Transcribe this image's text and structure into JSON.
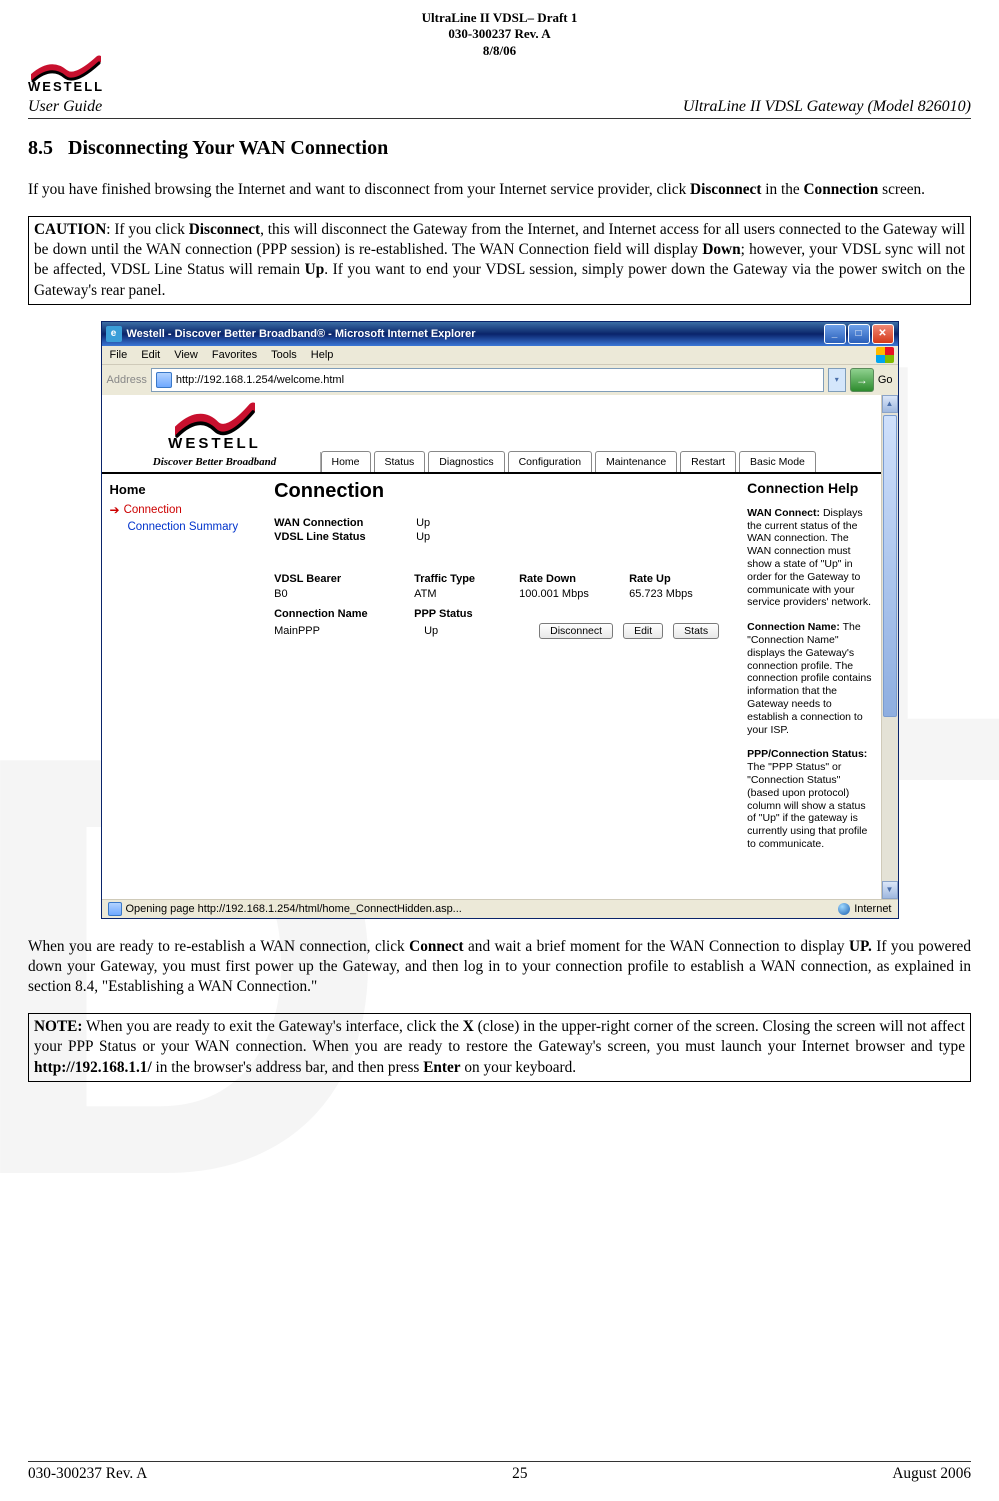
{
  "header": {
    "line1": "UltraLine II VDSL– Draft 1",
    "line2": "030-300237 Rev. A",
    "line3": "8/8/06",
    "logo_text": "WESTELL",
    "guide_left": "User Guide",
    "guide_right": "UltraLine II VDSL Gateway (Model 826010)"
  },
  "section": {
    "number": "8.5",
    "title": "Disconnecting Your WAN Connection"
  },
  "para1": {
    "t1": "If you have finished browsing the Internet and want to disconnect from your Internet service provider, click ",
    "b1": "Disconnect",
    "t2": " in the ",
    "b2": "Connection",
    "t3": " screen."
  },
  "caution": {
    "b1": "CAUTION",
    "t1": ": If you click ",
    "b2": "Disconnect",
    "t2": ", this will disconnect the Gateway from the Internet, and Internet access for all users connected to the Gateway will be down until the WAN connection (PPP session) is re-established. The WAN Connection field will display ",
    "b3": "Down",
    "t3": "; however, your VDSL sync will not be affected, VDSL Line Status will remain ",
    "b4": "Up",
    "t4": ". If you want to end your VDSL session, simply power down the Gateway via the power switch on the Gateway's rear panel."
  },
  "screenshot": {
    "title": "Westell - Discover Better Broadband® - Microsoft Internet Explorer",
    "menu": [
      "File",
      "Edit",
      "View",
      "Favorites",
      "Tools",
      "Help"
    ],
    "address_label": "Address",
    "address_value": "http://192.168.1.254/welcome.html",
    "go_label": "Go",
    "logo_text": "WESTELL",
    "tagline": "Discover Better Broadband",
    "tabs": [
      "Home",
      "Status",
      "Diagnostics",
      "Configuration",
      "Maintenance",
      "Restart",
      "Basic Mode"
    ],
    "side": {
      "heading": "Home",
      "current": "Connection",
      "sub": "Connection Summary"
    },
    "main": {
      "title": "Connection",
      "kv": [
        {
          "k": "WAN Connection",
          "v": "Up"
        },
        {
          "k": "VDSL Line Status",
          "v": "Up"
        }
      ],
      "table1": {
        "headers": [
          "VDSL Bearer",
          "Traffic Type",
          "Rate Down",
          "Rate Up"
        ],
        "row": [
          "B0",
          "ATM",
          "100.001 Mbps",
          "65.723 Mbps"
        ]
      },
      "table2": {
        "headers": [
          "Connection Name",
          "PPP Status"
        ],
        "row": [
          "MainPPP",
          "Up"
        ]
      },
      "buttons": {
        "disconnect": "Disconnect",
        "edit": "Edit",
        "stats": "Stats"
      }
    },
    "help": {
      "title": "Connection Help",
      "items": [
        {
          "b": "WAN Connect:",
          "t": " Displays the current status of the WAN connection. The WAN connection must show a state of \"Up\" in order for the Gateway to communicate with your service providers' network."
        },
        {
          "b": "Connection Name:",
          "t": " The \"Connection Name\" displays the Gateway's connection profile. The connection profile contains information that the Gateway needs to establish a connection to your ISP."
        },
        {
          "b": "PPP/Connection Status:",
          "t": " The \"PPP Status\" or \"Connection Status\" (based upon protocol) column will show a status of \"Up\" if the gateway is currently using that profile to communicate."
        }
      ]
    },
    "status_left": "Opening page http://192.168.1.254/html/home_ConnectHidden.asp...",
    "status_right": "Internet"
  },
  "para2": {
    "t1": "When you are ready to re-establish a WAN connection, click ",
    "b1": "Connect",
    "t2": " and wait a brief moment for the WAN Connection to display ",
    "b2": "UP.",
    "t3": " If you powered down your Gateway, you must first power up the Gateway, and then log in to your connection profile to establish a WAN connection, as explained in section 8.4, \"Establishing a WAN Connection.\""
  },
  "note": {
    "b1": "NOTE:",
    "t1": " When you are ready to exit the Gateway's interface, click the ",
    "b2": "X",
    "t2": " (close) in the upper-right corner of the screen. Closing the screen will not affect your PPP Status or your WAN connection. When you are ready to restore the Gateway's screen, you must launch your Internet browser and type ",
    "b3": "http://192.168.1.1/",
    "t3": " in the browser's address bar, and then press ",
    "b4": "Enter",
    "t4": " on your keyboard."
  },
  "footer": {
    "left": "030-300237 Rev. A",
    "center": "25",
    "right": "August 2006"
  }
}
